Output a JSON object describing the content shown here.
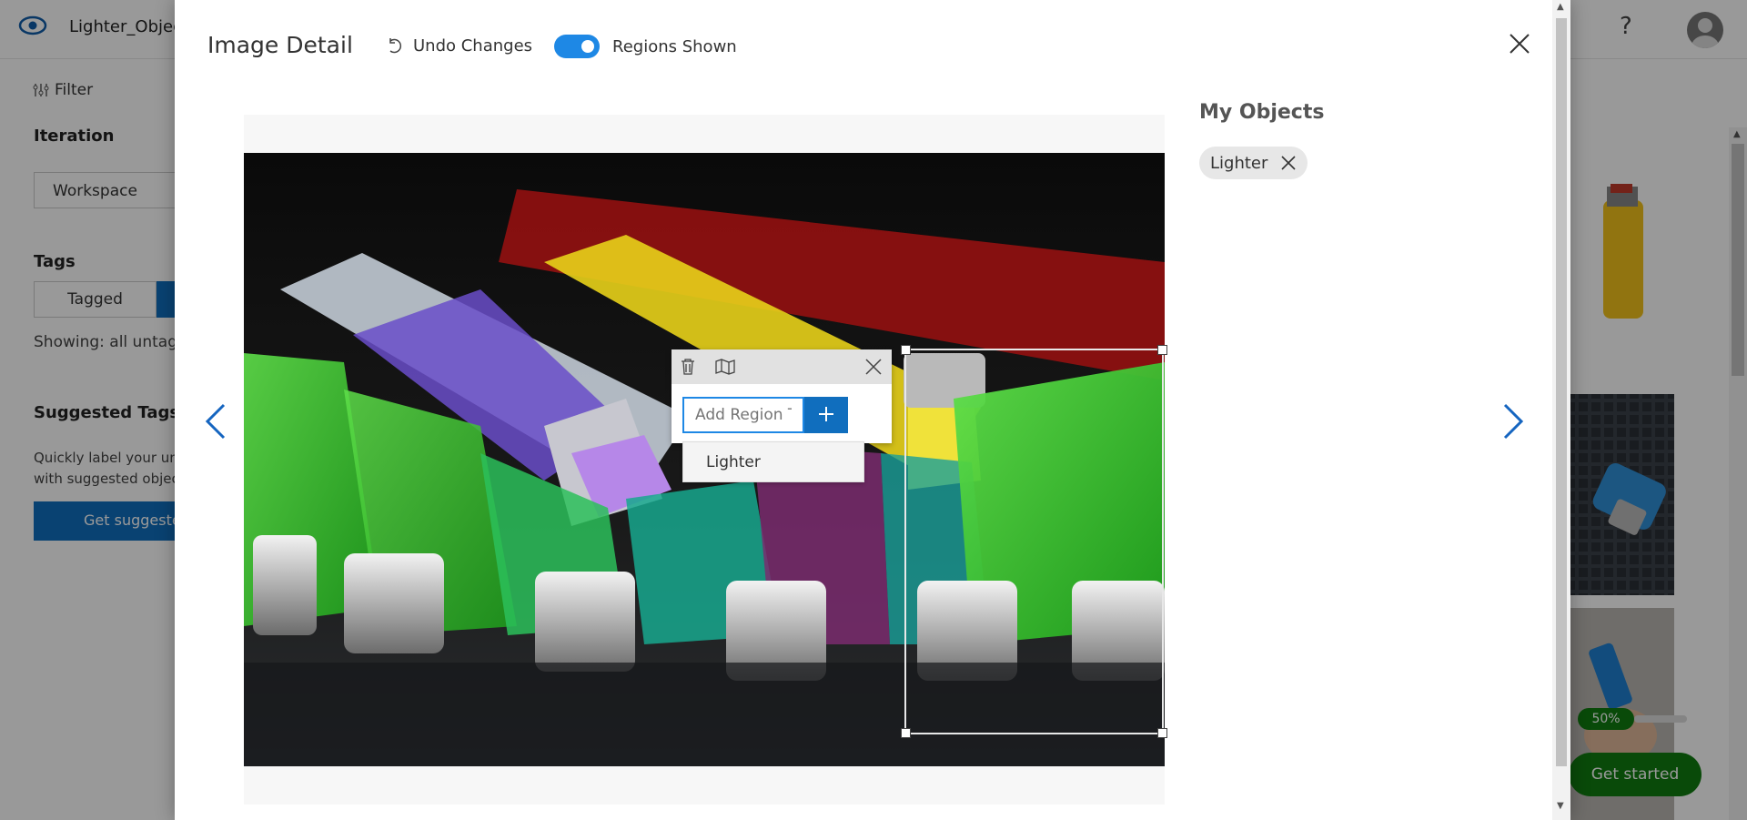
{
  "app": {
    "project_title": "Lighter_Object",
    "filter_label": "Filter",
    "iteration_heading": "Iteration",
    "iteration_value": "Workspace",
    "tags_heading": "Tags",
    "tagged_label": "Tagged",
    "showing_text": "Showing: all untagg",
    "suggested_heading": "Suggested Tags",
    "suggested_desc_1": "Quickly label your unt",
    "suggested_desc_2": "with suggested object",
    "suggest_button": "Get suggeste",
    "help_glyph": "?",
    "progress_text": "50%",
    "get_started": "Get started"
  },
  "modal": {
    "title": "Image Detail",
    "undo_label": "Undo Changes",
    "regions_label": "Regions Shown",
    "regions_on": true,
    "my_objects_heading": "My Objects",
    "objects": [
      {
        "label": "Lighter"
      }
    ],
    "region_popup": {
      "placeholder": "Add Region Tag",
      "suggestions": [
        "Lighter"
      ]
    }
  },
  "colors": {
    "accent": "#1e88e5",
    "primary_button": "#106ebe",
    "nav_arrow": "#1565c0",
    "get_started": "#107c10"
  }
}
